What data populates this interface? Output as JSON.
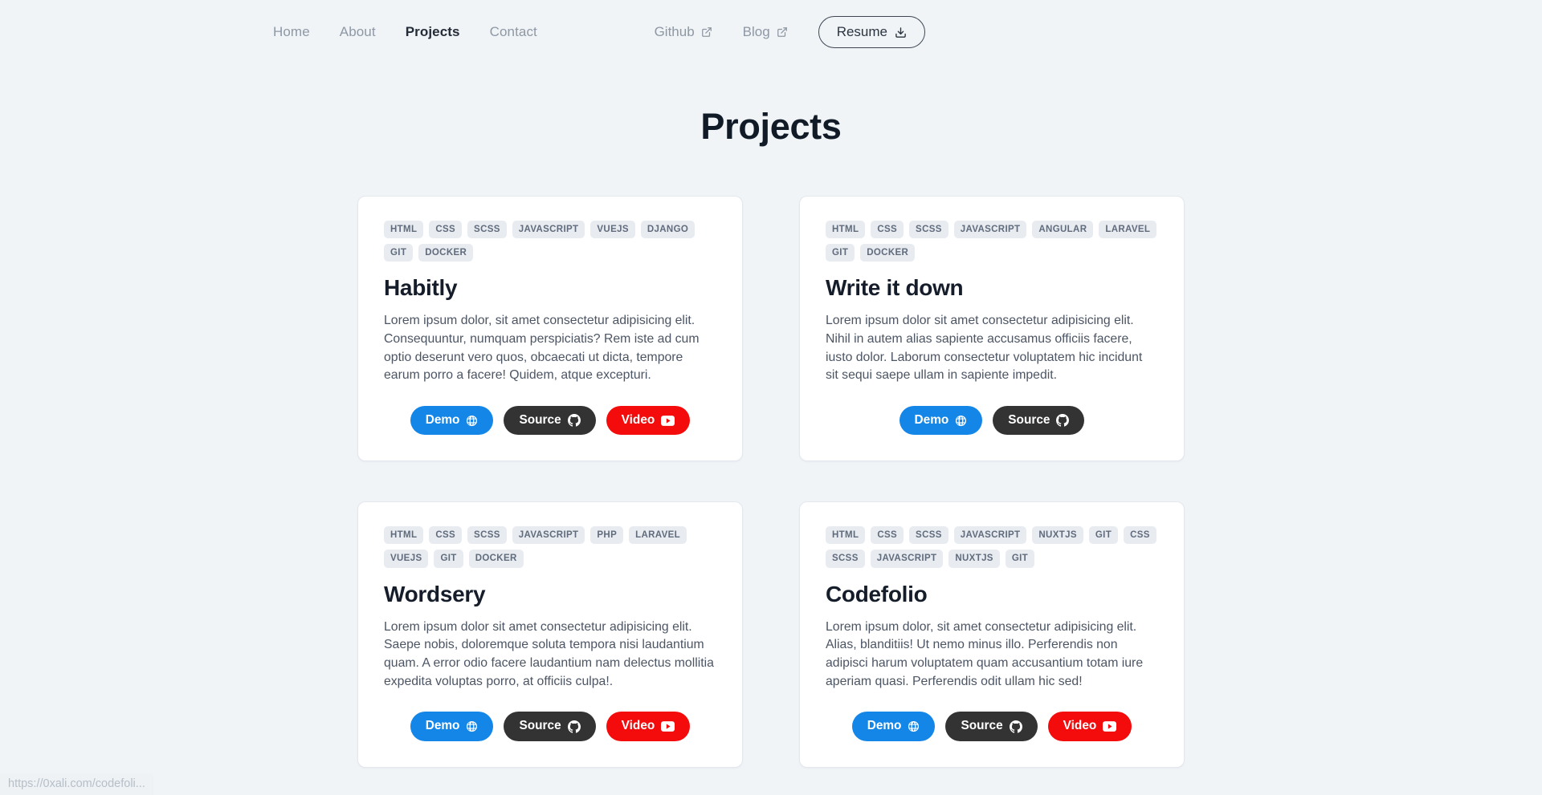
{
  "nav": {
    "links": [
      {
        "label": "Home",
        "active": false
      },
      {
        "label": "About",
        "active": false
      },
      {
        "label": "Projects",
        "active": true
      },
      {
        "label": "Contact",
        "active": false
      }
    ],
    "external": [
      {
        "label": "Github",
        "icon": "external-link-icon"
      },
      {
        "label": "Blog",
        "icon": "external-link-icon"
      }
    ],
    "resume": {
      "label": "Resume",
      "icon": "download-icon"
    }
  },
  "header": {
    "title": "Projects"
  },
  "projects": [
    {
      "tags": [
        "HTML",
        "CSS",
        "SCSS",
        "JAVASCRIPT",
        "VUEJS",
        "DJANGO",
        "GIT",
        "DOCKER"
      ],
      "title": "Habitly",
      "description": "Lorem ipsum dolor, sit amet consectetur adipisicing elit. Consequuntur, numquam perspiciatis? Rem iste ad cum optio deserunt vero quos, obcaecati ut dicta, tempore earum porro a facere! Quidem, atque excepturi.",
      "buttons": [
        {
          "label": "Demo",
          "kind": "demo",
          "icon": "globe-icon"
        },
        {
          "label": "Source",
          "kind": "source",
          "icon": "github-icon"
        },
        {
          "label": "Video",
          "kind": "video",
          "icon": "youtube-icon"
        }
      ]
    },
    {
      "tags": [
        "HTML",
        "CSS",
        "SCSS",
        "JAVASCRIPT",
        "ANGULAR",
        "LARAVEL",
        "GIT",
        "DOCKER"
      ],
      "title": "Write it down",
      "description": "Lorem ipsum dolor sit amet consectetur adipisicing elit. Nihil in autem alias sapiente accusamus officiis facere, iusto dolor. Laborum consectetur voluptatem hic incidunt sit sequi saepe ullam in sapiente impedit.",
      "buttons": [
        {
          "label": "Demo",
          "kind": "demo",
          "icon": "globe-icon"
        },
        {
          "label": "Source",
          "kind": "source",
          "icon": "github-icon"
        }
      ]
    },
    {
      "tags": [
        "HTML",
        "CSS",
        "SCSS",
        "JAVASCRIPT",
        "PHP",
        "LARAVEL",
        "VUEJS",
        "GIT",
        "DOCKER"
      ],
      "title": "Wordsery",
      "description": "Lorem ipsum dolor sit amet consectetur adipisicing elit. Saepe nobis, doloremque soluta tempora nisi laudantium quam. A error odio facere laudantium nam delectus mollitia expedita voluptas porro, at officiis culpa!.",
      "buttons": [
        {
          "label": "Demo",
          "kind": "demo",
          "icon": "globe-icon"
        },
        {
          "label": "Source",
          "kind": "source",
          "icon": "github-icon"
        },
        {
          "label": "Video",
          "kind": "video",
          "icon": "youtube-icon"
        }
      ]
    },
    {
      "tags": [
        "HTML",
        "CSS",
        "SCSS",
        "JAVASCRIPT",
        "NUXTJS",
        "GIT",
        "CSS",
        "SCSS",
        "JAVASCRIPT",
        "NUXTJS",
        "GIT"
      ],
      "title": "Codefolio",
      "description": "Lorem ipsum dolor, sit amet consectetur adipisicing elit. Alias, blanditiis! Ut nemo minus illo. Perferendis non adipisci harum voluptatem quam accusantium totam iure aperiam quasi. Perferendis odit ullam hic sed!",
      "buttons": [
        {
          "label": "Demo",
          "kind": "demo",
          "icon": "globe-icon"
        },
        {
          "label": "Source",
          "kind": "source",
          "icon": "github-icon"
        },
        {
          "label": "Video",
          "kind": "video",
          "icon": "youtube-icon"
        }
      ]
    }
  ],
  "status_bar": {
    "url": "https://0xali.com/codefoli..."
  },
  "colors": {
    "page_background": "#f0f4f7",
    "card_background": "#ffffff",
    "tag_background": "#e8ecf1",
    "demo_blue": "#1386e8",
    "source_dark": "#333333",
    "video_red": "#f40b0b",
    "nav_muted": "#8e98a5",
    "heading": "#111a27"
  }
}
